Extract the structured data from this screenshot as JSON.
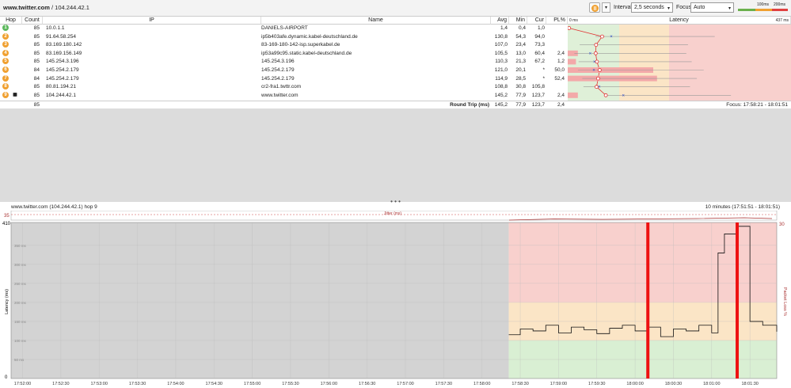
{
  "breadcrumb": {
    "host": "www.twitter.com",
    "sep": " / ",
    "ip": "104.244.42.1"
  },
  "toolbar": {
    "pause_icon": "pause-icon",
    "interval_label": "Interval",
    "interval_value": "2,5 seconds",
    "focus_label": "Focus",
    "focus_value": "Auto",
    "legend_100": "100ms",
    "legend_200": "200ms"
  },
  "columns": {
    "hop": "Hop",
    "count": "Count",
    "ip": "IP",
    "name": "Name",
    "avg": "Avg",
    "min": "Min",
    "cur": "Cur",
    "pl": "PL%",
    "zero": "0 ms",
    "latency": "Latency",
    "max": "437 ms"
  },
  "hops": [
    {
      "hop": "1",
      "color": "#5cb85c",
      "count": "85",
      "ip": "10.0.1.1",
      "name": "DANIELS-AIRPORT",
      "avg": "1,4",
      "min": "0,4",
      "cur": "1,0",
      "pl": ""
    },
    {
      "hop": "2",
      "color": "#f0a030",
      "count": "85",
      "ip": "91.64.58.254",
      "name": "ip5b403afe.dynamic.kabel-deutschland.de",
      "avg": "130,8",
      "min": "54,3",
      "cur": "94,0",
      "pl": ""
    },
    {
      "hop": "3",
      "color": "#f0a030",
      "count": "85",
      "ip": "83.169.180.142",
      "name": "83-169-180-142-isp.superkabel.de",
      "avg": "107,0",
      "min": "23,4",
      "cur": "73,3",
      "pl": ""
    },
    {
      "hop": "4",
      "color": "#f0a030",
      "count": "85",
      "ip": "83.169.156.149",
      "name": "ip53a99c95.static.kabel-deutschland.de",
      "avg": "105,5",
      "min": "13,0",
      "cur": "60,4",
      "pl": "2,4"
    },
    {
      "hop": "5",
      "color": "#f0a030",
      "count": "85",
      "ip": "145.254.3.196",
      "name": "145.254.3.196",
      "avg": "110,3",
      "min": "21,3",
      "cur": "67,2",
      "pl": "1,2"
    },
    {
      "hop": "6",
      "color": "#f0a030",
      "count": "84",
      "ip": "145.254.2.179",
      "name": "145.254.2.179",
      "avg": "121,0",
      "min": "20,1",
      "cur": "*",
      "pl": "50,0"
    },
    {
      "hop": "7",
      "color": "#f0a030",
      "count": "84",
      "ip": "145.254.2.179",
      "name": "145.254.2.179",
      "avg": "114,9",
      "min": "28,5",
      "cur": "*",
      "pl": "52,4"
    },
    {
      "hop": "8",
      "color": "#f0a030",
      "count": "85",
      "ip": "80.81.194.21",
      "name": "cr2-fra1.twttr.com",
      "avg": "108,8",
      "min": "30,8",
      "cur": "105,8",
      "pl": ""
    },
    {
      "hop": "9",
      "color": "#f0a030",
      "count": "85",
      "ip": "104.244.42.1",
      "name": "www.twitter.com",
      "avg": "145,2",
      "min": "77,9",
      "cur": "123,7",
      "pl": "2,4"
    }
  ],
  "round_trip": {
    "count": "85",
    "label": "Round Trip (ms)",
    "avg": "145,2",
    "min": "77,9",
    "cur": "123,7",
    "pl": "2,4",
    "focus": "Focus: 17:58:21 - 18:01:51"
  },
  "graph": {
    "title": "www.twitter.com (104.244.42.1) hop 9",
    "range": "10 minutes (17:51:51 - 18:01:51)",
    "jitter_label": "Jitter (ms)",
    "jitter_max": "35",
    "ylabel": "Latency (ms)",
    "y2label": "Packet Loss %",
    "y2_top": "30",
    "y_top": "410",
    "y_bottom": "0",
    "xticks": [
      "17:52:00",
      "17:52:30",
      "17:53:00",
      "17:53:30",
      "17:54:00",
      "17:54:30",
      "17:55:00",
      "17:55:30",
      "17:56:00",
      "17:56:30",
      "17:57:00",
      "17:57:30",
      "17:58:00",
      "17:58:30",
      "17:59:00",
      "17:59:30",
      "18:00:00",
      "18:00:30",
      "18:01:00",
      "18:01:30"
    ],
    "yticks": [
      "350 ms",
      "300 ms",
      "250 ms",
      "200 ms",
      "150 ms",
      "100 ms",
      "50 ms"
    ]
  },
  "chart_data": {
    "type": "line",
    "title": "www.twitter.com (104.244.42.1) hop 9",
    "ylabel": "Latency (ms)",
    "ylim": [
      0,
      410
    ],
    "x": [
      "17:58:21",
      "17:58:30",
      "17:58:40",
      "17:58:50",
      "17:59:00",
      "17:59:10",
      "17:59:20",
      "17:59:30",
      "17:59:40",
      "17:59:50",
      "18:00:00",
      "18:00:10",
      "18:00:20",
      "18:00:30",
      "18:00:40",
      "18:00:50",
      "18:01:00",
      "18:01:05",
      "18:01:10",
      "18:01:20",
      "18:01:30",
      "18:01:40",
      "18:01:51"
    ],
    "series": [
      {
        "values": [
          115,
          130,
          125,
          140,
          120,
          135,
          128,
          118,
          132,
          140,
          125,
          135,
          110,
          130,
          125,
          140,
          120,
          330,
          380,
          400,
          150,
          140,
          123
        ]
      }
    ],
    "packet_loss_markers": [
      "18:00:10",
      "18:01:20"
    ],
    "colors": {
      "good": "#d9efd3",
      "warn": "#fbe5c6",
      "bad": "#f8d0cd",
      "loss": "#ee1111"
    }
  }
}
